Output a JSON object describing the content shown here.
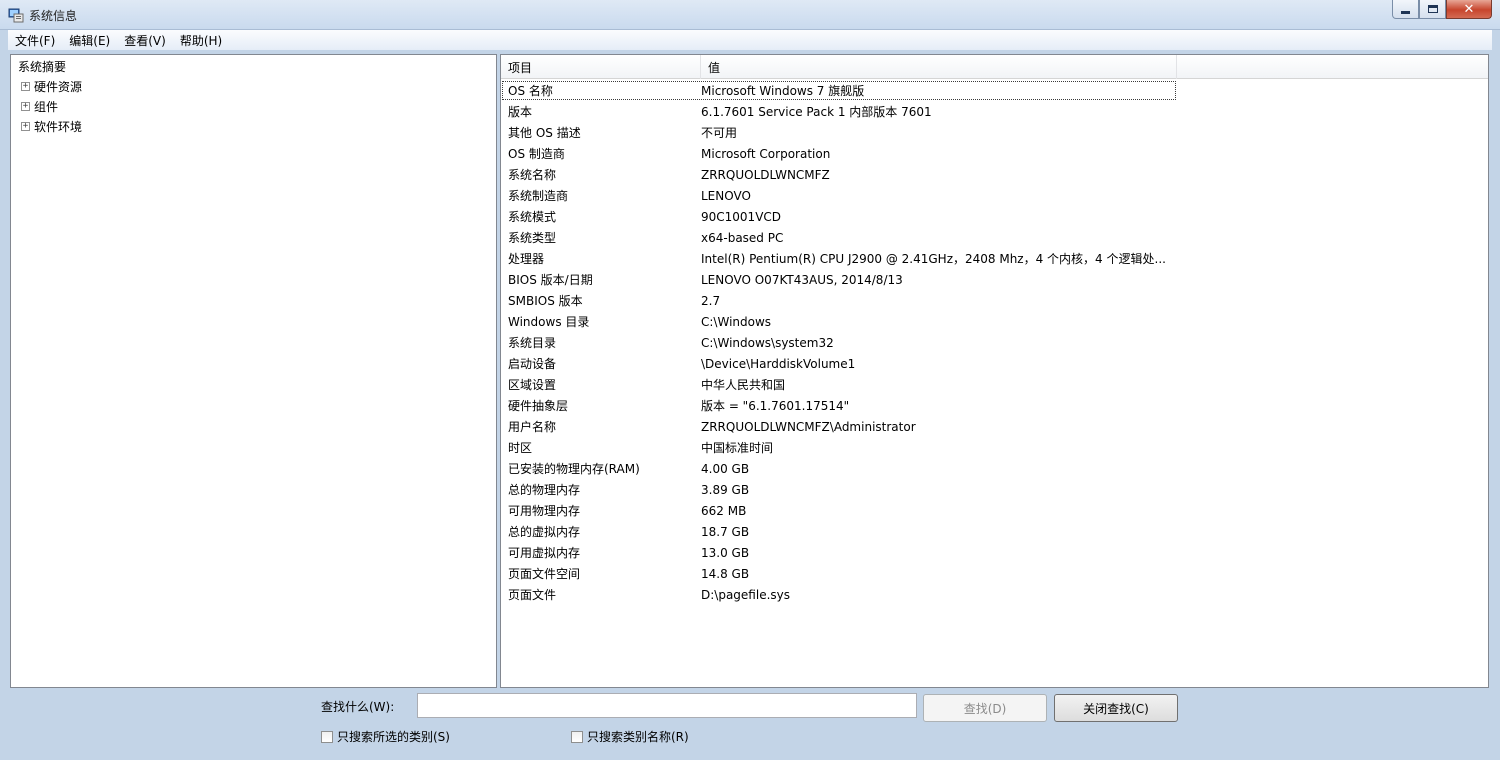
{
  "window": {
    "title": "系统信息"
  },
  "menu": [
    {
      "label": "文件(F)"
    },
    {
      "label": "编辑(E)"
    },
    {
      "label": "查看(V)"
    },
    {
      "label": "帮助(H)"
    }
  ],
  "tree": {
    "root": "系统摘要",
    "children": [
      {
        "label": "硬件资源"
      },
      {
        "label": "组件"
      },
      {
        "label": "软件环境"
      }
    ],
    "expander_symbol": "+"
  },
  "table": {
    "headers": {
      "item": "项目",
      "value": "值"
    },
    "rows": [
      {
        "item": "OS 名称",
        "value": "Microsoft Windows 7 旗舰版"
      },
      {
        "item": "版本",
        "value": "6.1.7601 Service Pack 1 内部版本 7601"
      },
      {
        "item": "其他 OS 描述",
        "value": "不可用"
      },
      {
        "item": "OS 制造商",
        "value": "Microsoft Corporation"
      },
      {
        "item": "系统名称",
        "value": "ZRRQUOLDLWNCMFZ"
      },
      {
        "item": "系统制造商",
        "value": "LENOVO"
      },
      {
        "item": "系统模式",
        "value": "90C1001VCD"
      },
      {
        "item": "系统类型",
        "value": "x64-based PC"
      },
      {
        "item": "处理器",
        "value": "Intel(R) Pentium(R) CPU  J2900  @ 2.41GHz，2408 Mhz，4 个内核，4 个逻辑处..."
      },
      {
        "item": "BIOS 版本/日期",
        "value": "LENOVO O07KT43AUS, 2014/8/13"
      },
      {
        "item": "SMBIOS 版本",
        "value": "2.7"
      },
      {
        "item": "Windows 目录",
        "value": "C:\\Windows"
      },
      {
        "item": "系统目录",
        "value": "C:\\Windows\\system32"
      },
      {
        "item": "启动设备",
        "value": "\\Device\\HarddiskVolume1"
      },
      {
        "item": "区域设置",
        "value": "中华人民共和国"
      },
      {
        "item": "硬件抽象层",
        "value": "版本 = \"6.1.7601.17514\""
      },
      {
        "item": "用户名称",
        "value": "ZRRQUOLDLWNCMFZ\\Administrator"
      },
      {
        "item": "时区",
        "value": "中国标准时间"
      },
      {
        "item": "已安装的物理内存(RAM)",
        "value": "4.00 GB"
      },
      {
        "item": "总的物理内存",
        "value": "3.89 GB"
      },
      {
        "item": "可用物理内存",
        "value": "662 MB"
      },
      {
        "item": "总的虚拟内存",
        "value": "18.7 GB"
      },
      {
        "item": "可用虚拟内存",
        "value": "13.0 GB"
      },
      {
        "item": "页面文件空间",
        "value": "14.8 GB"
      },
      {
        "item": "页面文件",
        "value": "D:\\pagefile.sys"
      }
    ]
  },
  "find": {
    "label": "查找什么(W):",
    "input_value": "",
    "find_button": "查找(D)",
    "close_button": "关闭查找(C)",
    "checkbox_selected_category": "只搜索所选的类别(S)",
    "checkbox_category_names": "只搜索类别名称(R)"
  }
}
